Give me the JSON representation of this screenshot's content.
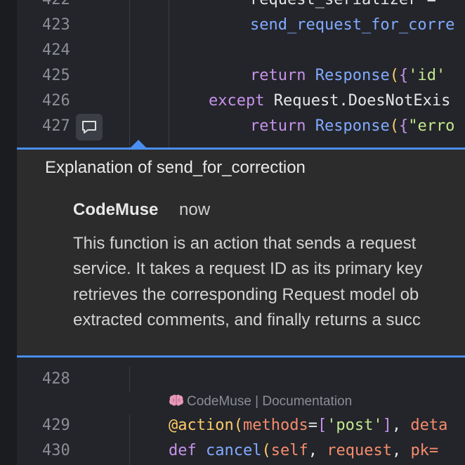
{
  "code_top": [
    {
      "num": "422",
      "text": "request_serializer = "
    },
    {
      "num": "423",
      "text": "send_request_for_corre"
    },
    {
      "num": "424",
      "text": ""
    },
    {
      "num": "425",
      "return_kw": "return",
      "call": "Response",
      "paren": "(",
      "brace": "{",
      "str": "'id'"
    },
    {
      "num": "426",
      "except_kw": "except",
      "rest": "Request.DoesNotExis"
    },
    {
      "num": "427",
      "return_kw": "return",
      "call": "Response",
      "paren": "(",
      "brace": "{",
      "str": "\"erro"
    }
  ],
  "comment_button_icon": "comment-icon",
  "panel": {
    "title": "Explanation of send_for_correction",
    "author": "CodeMuse",
    "time": "now",
    "body_lines": [
      "This function is an action that sends a request",
      "service. It takes a request ID as its primary key",
      "retrieves the corresponding Request model ob",
      "extracted comments, and finally returns a succ"
    ]
  },
  "code_bottom": {
    "line_428": "428",
    "codelens": {
      "icon": "brain-icon",
      "text": "CodeMuse | Documentation"
    },
    "line_429": {
      "num": "429",
      "decorator": "@action",
      "paren": "(",
      "param": "methods",
      "eq": "=",
      "bracket": "[",
      "str": "'post'",
      "bracket_close": "]",
      "comma": ", ",
      "more": "deta"
    },
    "line_430": {
      "num": "430",
      "def_kw": "def",
      "name": "cancel",
      "paren": "(",
      "p1": "self",
      "c1": ", ",
      "p2": "request",
      "c2": ", ",
      "p3": "pk="
    }
  },
  "colors": {
    "accent": "#4a8ef0",
    "panel_bg": "#2c2c2c",
    "editor_bg": "#23252a"
  }
}
